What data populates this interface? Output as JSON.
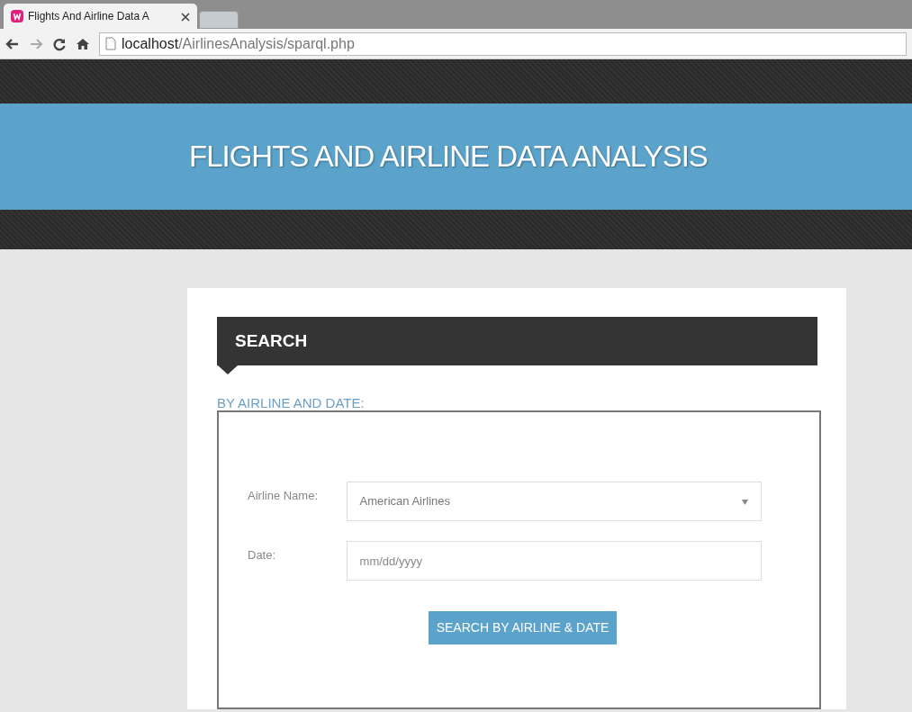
{
  "browser": {
    "tab": {
      "title": "Flights And Airline Data A",
      "selected": true
    },
    "url_host": "localhost",
    "url_path": "/AirlinesAnalysis/sparql.php"
  },
  "header": {
    "title": "FLIGHTS AND AIRLINE DATA ANALYSIS"
  },
  "panel": {
    "title": "SEARCH",
    "subtitle": "BY AIRLINE AND DATE:",
    "fields": [
      {
        "kind": "select",
        "label": "Airline Name:",
        "value": "American Airlines"
      },
      {
        "kind": "date",
        "label": "Date:",
        "placeholder": "mm/dd/yyyy"
      }
    ],
    "button": "SEARCH BY AIRLINE & DATE"
  }
}
